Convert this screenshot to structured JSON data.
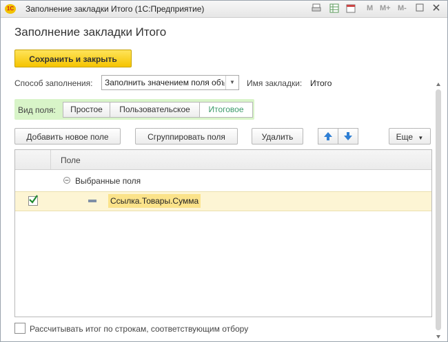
{
  "window": {
    "title": "Заполнение закладки Итого  (1С:Предприятие)",
    "logo_text": "1С",
    "toolbar_m": [
      "M",
      "M+",
      "M-"
    ],
    "calendar_day": "31"
  },
  "form": {
    "heading": "Заполнение закладки Итого",
    "save_close": "Сохранить и закрыть",
    "fill_method_label": "Способ заполнения:",
    "fill_method_value": "Заполнить значением поля объекта",
    "tab_name_label": "Имя закладки:",
    "tab_name_value": "Итого"
  },
  "field_view": {
    "label": "Вид поля:",
    "options": [
      "Простое",
      "Пользовательское",
      "Итоговое"
    ],
    "selected": "Итоговое"
  },
  "commands": {
    "add_field": "Добавить новое поле",
    "group_fields": "Сгруппировать поля",
    "delete": "Удалить",
    "more": "Еще"
  },
  "table": {
    "column_header": "Поле",
    "group_label": "Выбранные поля",
    "rows": [
      {
        "checked": true,
        "value": "Ссылка.Товары.Сумма"
      }
    ]
  },
  "footer": {
    "checkbox_label": "Рассчитывать итог по строкам, соответствующим отбору",
    "checked": false
  },
  "colors": {
    "accent_yellow": "#f5c400",
    "segment_bg": "#d8f4c8",
    "selected_row": "#fdf5d4",
    "active_text": "#3c9a6a"
  }
}
